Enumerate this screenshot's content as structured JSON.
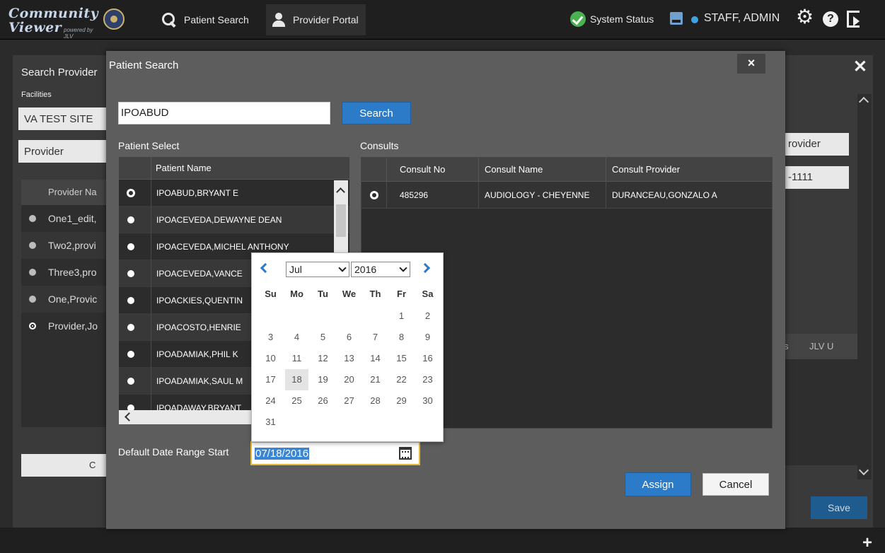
{
  "app": {
    "logo_line1": "Community",
    "logo_line2": "Viewer",
    "logo_tagline": "powered by JLV"
  },
  "nav": {
    "patient_search": "Patient Search",
    "provider_portal": "Provider Portal",
    "system_status": "System Status",
    "user": "STAFF, ADMIN"
  },
  "background": {
    "title": "Search Provider",
    "facilities_label": "Facilities",
    "facility_value": "VA TEST SITE",
    "provider_value": "Provider",
    "table_header": "Provider Na",
    "rows": [
      "One1_edit,",
      "Two2,provi",
      "Three3,pro",
      "One,Provic",
      "Provider,Jo"
    ],
    "bottom_button": "C",
    "right_provider": "rovider",
    "right_phone": "-1111",
    "right_table_header": "JLV U",
    "save": "Save"
  },
  "modal": {
    "title": "Patient Search",
    "close": "×",
    "search_value": "IPOABUD",
    "search_button": "Search",
    "patient_select_label": "Patient Select",
    "consults_label": "Consults",
    "patient_table": {
      "header": "Patient Name",
      "rows": [
        "IPOABUD,BRYANT E",
        "IPOACEVEDA,DEWAYNE DEAN",
        "IPOACEVEDA,MICHEL ANTHONY",
        "IPOACEVEDA,VANCE",
        "IPOACKIES,QUENTIN",
        "IPOACOSTO,HENRIE",
        "IPOADAMIAK,PHIL K",
        "IPOADAMIAK,SAUL M",
        "IPOADAWAY,BRYANT"
      ]
    },
    "consult_table": {
      "headers": [
        "",
        "Consult No",
        "Consult Name",
        "Consult Provider"
      ],
      "rows": [
        {
          "no": "485296",
          "name": "AUDIOLOGY - CHEYENNE",
          "provider": "DURANCEAU,GONZALO A"
        }
      ]
    },
    "date_label": "Default Date Range Start",
    "date_value": "07/18/2016",
    "assign_button": "Assign",
    "cancel_button": "Cancel"
  },
  "datepicker": {
    "month": "Jul",
    "year": "2016",
    "weekdays": [
      "Su",
      "Mo",
      "Tu",
      "We",
      "Th",
      "Fr",
      "Sa"
    ],
    "weeks": [
      [
        "",
        "",
        "",
        "",
        "",
        "1",
        "2"
      ],
      [
        "3",
        "4",
        "5",
        "6",
        "7",
        "8",
        "9"
      ],
      [
        "10",
        "11",
        "12",
        "13",
        "14",
        "15",
        "16"
      ],
      [
        "17",
        "18",
        "19",
        "20",
        "21",
        "22",
        "23"
      ],
      [
        "24",
        "25",
        "26",
        "27",
        "28",
        "29",
        "30"
      ],
      [
        "31",
        "",
        "",
        "",
        "",
        "",
        ""
      ]
    ],
    "selected_day": "18"
  },
  "colors": {
    "accent_blue": "#2b7bc8",
    "status_green": "#4bb04f",
    "focus_yellow": "#e2b93b",
    "danger_red": "#a23c3c"
  }
}
